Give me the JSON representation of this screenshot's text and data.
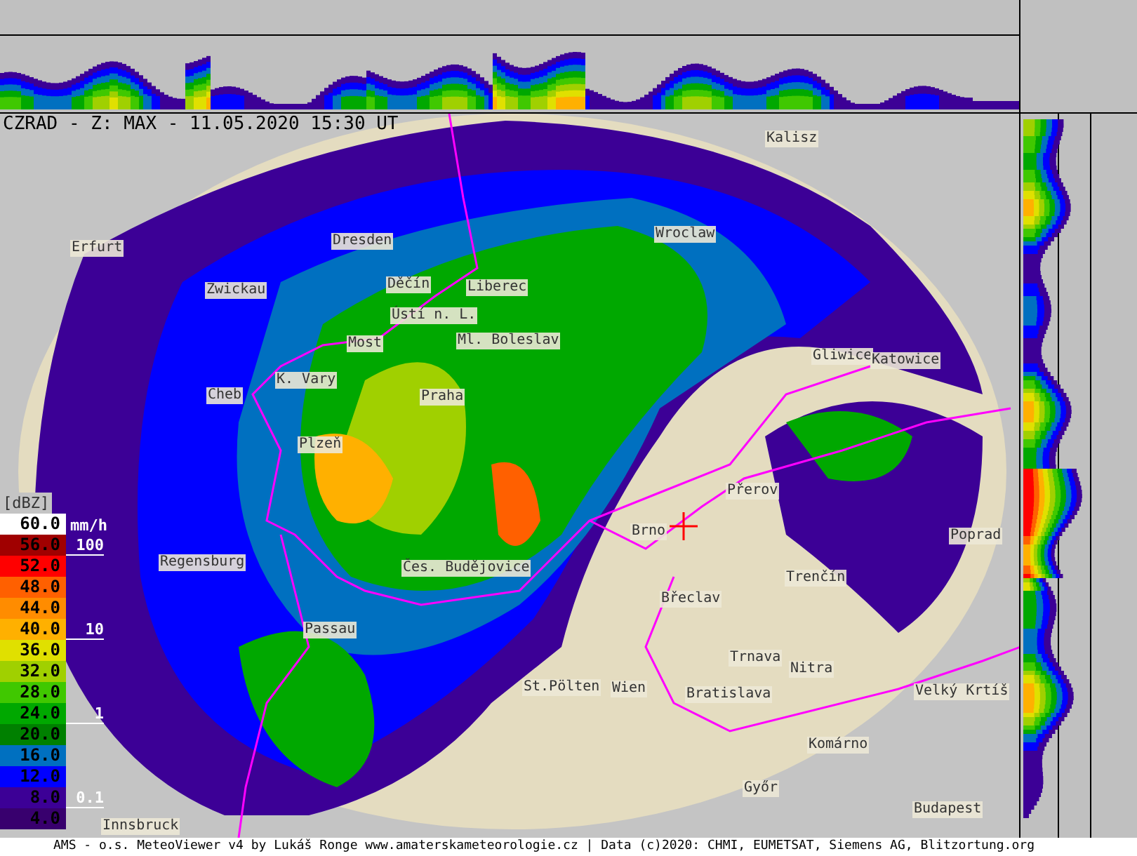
{
  "title": "CZRAD - Z: MAX - 11.05.2020 15:30 UT",
  "legend": {
    "unit": "[dBZ]",
    "rate_unit": "mm/h",
    "levels": [
      {
        "label": "60.0",
        "color": "#ffffff"
      },
      {
        "label": "56.0",
        "color": "#a00000"
      },
      {
        "label": "52.0",
        "color": "#ff0000"
      },
      {
        "label": "48.0",
        "color": "#ff6000"
      },
      {
        "label": "44.0",
        "color": "#ff8c00"
      },
      {
        "label": "40.0",
        "color": "#ffb000"
      },
      {
        "label": "36.0",
        "color": "#e0e000"
      },
      {
        "label": "32.0",
        "color": "#a0d000"
      },
      {
        "label": "28.0",
        "color": "#40c800"
      },
      {
        "label": "24.0",
        "color": "#00a800"
      },
      {
        "label": "20.0",
        "color": "#008000"
      },
      {
        "label": "16.0",
        "color": "#0070c0"
      },
      {
        "label": "12.0",
        "color": "#0000ff"
      },
      {
        "label": "8.0",
        "color": "#3c0096"
      },
      {
        "label": "4.0",
        "color": "#38006e"
      }
    ],
    "rate_marks": [
      "100",
      "10",
      "1",
      "0.1"
    ]
  },
  "cities": [
    "Kalisz",
    "Erfurt",
    "Dresden",
    "Wroclaw",
    "Zwickau",
    "Děčín",
    "Liberec",
    "Ústí n. L.",
    "Most",
    "Ml. Boleslav",
    "Gliwice",
    "Katowice",
    "Cheb",
    "K. Vary",
    "Praha",
    "Plzeň",
    "Přerov",
    "Brno",
    "Poprad",
    "Regensburg",
    "Čes. Budějovice",
    "Trenčín",
    "Břeclav",
    "Passau",
    "Trnava",
    "Nitra",
    "St.Pölten",
    "Wien",
    "Bratislava",
    "Velký Krtíš",
    "Komárno",
    "Győr",
    "Budapest",
    "Innsbruck"
  ],
  "status_bar": "AMS - o.s. MeteoViewer v4 by Lukáš Ronge www.amaterskameteorologie.cz | Data (c)2020: CHMI, EUMETSAT, Siemens AG, Blitzortung.org"
}
